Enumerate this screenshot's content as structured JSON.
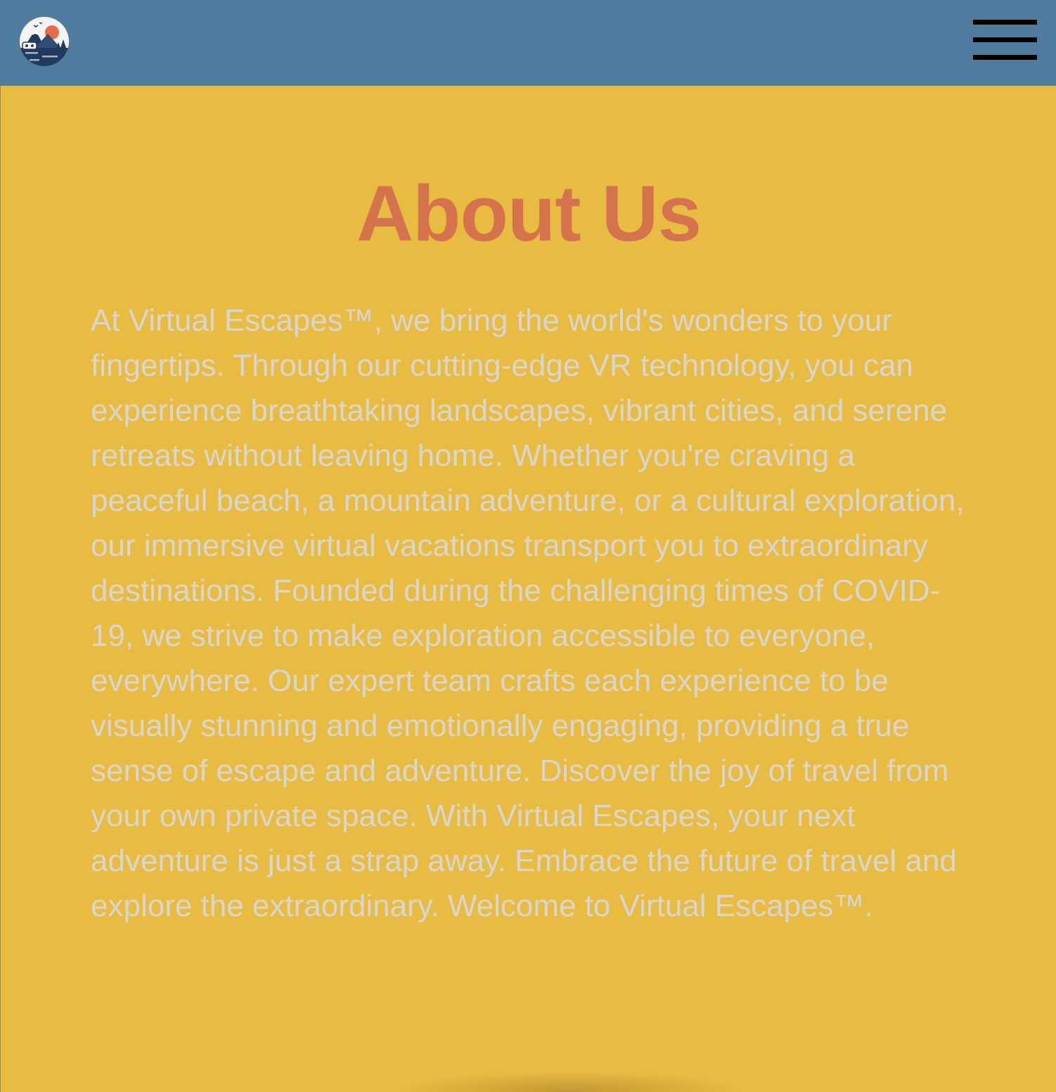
{
  "header": {
    "logo_icon": "virtual-escapes-logo-icon",
    "menu_icon": "hamburger-menu-icon",
    "background_color": "#4f7b9e"
  },
  "main": {
    "title": "About Us",
    "title_color": "#d5734d",
    "background_color": "#e8bb42",
    "body": "At Virtual Escapes™, we bring the world's wonders to your fingertips. Through our cutting-edge VR technology, you can experience breathtaking landscapes, vibrant cities, and serene retreats without leaving home. Whether you're craving a peaceful beach, a mountain adventure, or a cultural exploration, our immersive virtual vacations transport you to extraordinary destinations. Founded during the challenging times of COVID-19, we strive to make exploration accessible to everyone, everywhere. Our expert team crafts each experience to be visually stunning and emotionally engaging, providing a true sense of escape and adventure. Discover the joy of travel from your own private space. With Virtual Escapes, your next adventure is just a strap away. Embrace the future of travel and explore the extraordinary. Welcome to Virtual Escapes™.",
    "body_color": "#d8d6cf"
  }
}
